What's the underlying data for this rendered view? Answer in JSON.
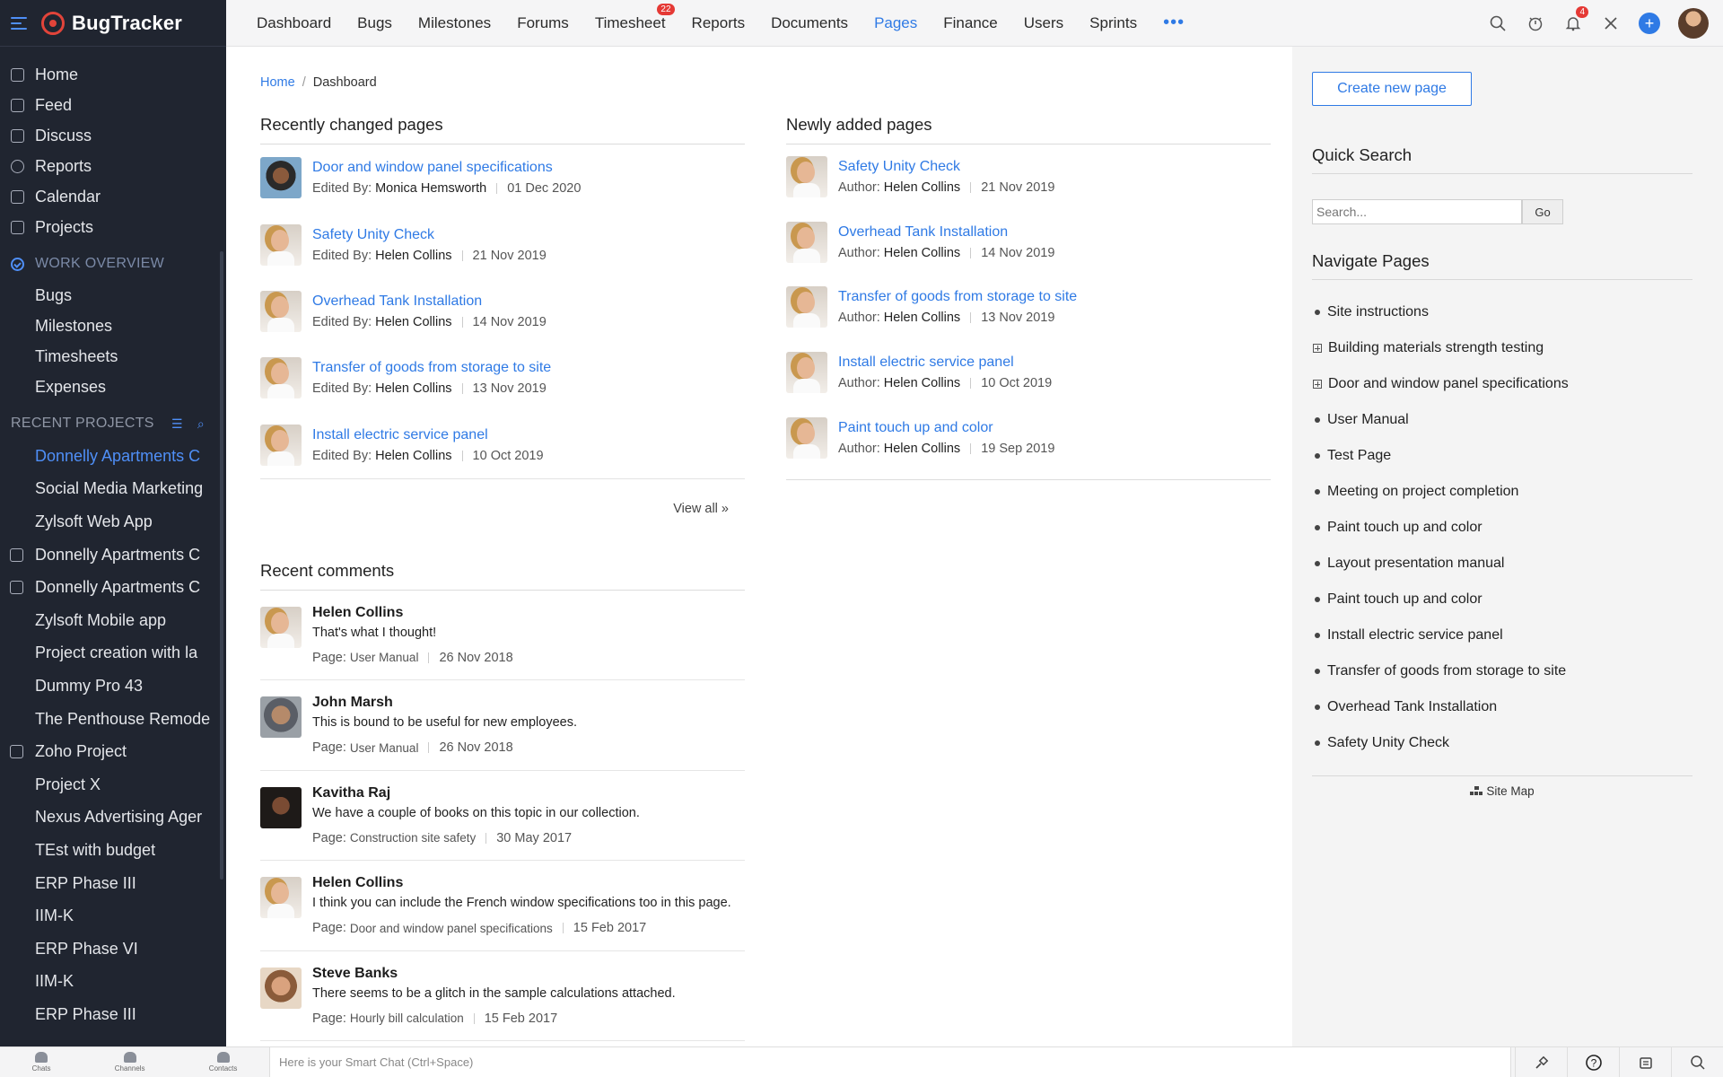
{
  "app": {
    "name": "BugTracker"
  },
  "sidebar": {
    "main_items": [
      {
        "label": "Home",
        "icon": "home-icon"
      },
      {
        "label": "Feed",
        "icon": "feed-icon"
      },
      {
        "label": "Discuss",
        "icon": "discuss-icon"
      },
      {
        "label": "Reports",
        "icon": "reports-icon"
      },
      {
        "label": "Calendar",
        "icon": "calendar-icon"
      },
      {
        "label": "Projects",
        "icon": "projects-icon"
      }
    ],
    "work_overview": {
      "heading": "WORK OVERVIEW",
      "items": [
        "Bugs",
        "Milestones",
        "Timesheets",
        "Expenses"
      ]
    },
    "recent_projects": {
      "heading": "RECENT PROJECTS",
      "items": [
        {
          "label": "Donnelly Apartments C",
          "active": true,
          "icon": false
        },
        {
          "label": "Social Media Marketing",
          "active": false,
          "icon": false
        },
        {
          "label": "Zylsoft Web App",
          "active": false,
          "icon": false
        },
        {
          "label": "Donnelly Apartments C",
          "active": false,
          "icon": true
        },
        {
          "label": "Donnelly Apartments C",
          "active": false,
          "icon": true
        },
        {
          "label": "Zylsoft Mobile app",
          "active": false,
          "icon": false
        },
        {
          "label": "Project creation with la",
          "active": false,
          "icon": false
        },
        {
          "label": "Dummy Pro 43",
          "active": false,
          "icon": false
        },
        {
          "label": "The Penthouse Remode",
          "active": false,
          "icon": false
        },
        {
          "label": "Zoho Project",
          "active": false,
          "icon": true
        },
        {
          "label": "Project X",
          "active": false,
          "icon": false
        },
        {
          "label": "Nexus Advertising Ager",
          "active": false,
          "icon": false
        },
        {
          "label": "TEst with budget",
          "active": false,
          "icon": false
        },
        {
          "label": "ERP Phase III",
          "active": false,
          "icon": false
        },
        {
          "label": "IIM-K",
          "active": false,
          "icon": false
        },
        {
          "label": "ERP Phase VI",
          "active": false,
          "icon": false
        },
        {
          "label": "IIM-K",
          "active": false,
          "icon": false
        },
        {
          "label": "ERP Phase III",
          "active": false,
          "icon": false
        }
      ]
    }
  },
  "topnav": {
    "items": [
      {
        "label": "Dashboard",
        "badge": ""
      },
      {
        "label": "Bugs",
        "badge": ""
      },
      {
        "label": "Milestones",
        "badge": ""
      },
      {
        "label": "Forums",
        "badge": ""
      },
      {
        "label": "Timesheet",
        "badge": "22"
      },
      {
        "label": "Reports",
        "badge": ""
      },
      {
        "label": "Documents",
        "badge": ""
      },
      {
        "label": "Pages",
        "badge": "",
        "active": true
      },
      {
        "label": "Finance",
        "badge": ""
      },
      {
        "label": "Users",
        "badge": ""
      },
      {
        "label": "Sprints",
        "badge": ""
      }
    ],
    "more": "•••",
    "notification_badge": "4",
    "accent": "#2f7ae5"
  },
  "breadcrumb": {
    "home": "Home",
    "separator": "/",
    "current": "Dashboard"
  },
  "recently_changed": {
    "title": "Recently changed pages",
    "meta_label": "Edited By:",
    "items": [
      {
        "title": "Door and window panel specifications",
        "by": "Monica Hemsworth",
        "date": "01 Dec 2020",
        "avatar": "monica"
      },
      {
        "title": "Safety Unity Check",
        "by": "Helen Collins",
        "date": "21 Nov 2019",
        "avatar": "helen"
      },
      {
        "title": "Overhead Tank Installation",
        "by": "Helen Collins",
        "date": "14 Nov 2019",
        "avatar": "helen"
      },
      {
        "title": "Transfer of goods from storage to site",
        "by": "Helen Collins",
        "date": "13 Nov 2019",
        "avatar": "helen"
      },
      {
        "title": "Install electric service panel",
        "by": "Helen Collins",
        "date": "10 Oct 2019",
        "avatar": "helen"
      }
    ],
    "view_all": "View all »"
  },
  "newly_added": {
    "title": "Newly added pages",
    "meta_label": "Author:",
    "items": [
      {
        "title": "Safety Unity Check",
        "by": "Helen Collins",
        "date": "21 Nov 2019"
      },
      {
        "title": "Overhead Tank Installation",
        "by": "Helen Collins",
        "date": "14 Nov 2019"
      },
      {
        "title": "Transfer of goods from storage to site",
        "by": "Helen Collins",
        "date": "13 Nov 2019"
      },
      {
        "title": "Install electric service panel",
        "by": "Helen Collins",
        "date": "10 Oct 2019"
      },
      {
        "title": "Paint touch up and color",
        "by": "Helen Collins",
        "date": "19 Sep 2019"
      }
    ]
  },
  "recent_comments": {
    "title": "Recent comments",
    "page_label": "Page:",
    "items": [
      {
        "name": "Helen Collins",
        "text": "That's what I thought!",
        "page": "User Manual",
        "date": "26 Nov 2018",
        "avatar": "helen"
      },
      {
        "name": "John Marsh",
        "text": "This is bound to be useful for new employees.",
        "page": "User Manual",
        "date": "26 Nov 2018",
        "avatar": "john"
      },
      {
        "name": "Kavitha Raj",
        "text": "We have a couple of books on this topic in our collection.",
        "page": "Construction site safety",
        "date": "30 May 2017",
        "avatar": "kavitha"
      },
      {
        "name": "Helen Collins",
        "text": "I think you can include the French window specifications too in this page.",
        "page": "Door and window panel specifications",
        "date": "15 Feb 2017",
        "avatar": "helen"
      },
      {
        "name": "Steve Banks",
        "text": "There seems to be a glitch in the sample calculations attached.",
        "page": "Hourly bill calculation",
        "date": "15 Feb 2017",
        "avatar": "steve"
      }
    ]
  },
  "right_panel": {
    "create_button": "Create new page",
    "quick_search": {
      "title": "Quick Search",
      "placeholder": "Search...",
      "go": "Go"
    },
    "navigate": {
      "title": "Navigate Pages",
      "items": [
        {
          "label": "Site instructions",
          "expandable": false
        },
        {
          "label": "Building materials strength testing",
          "expandable": true
        },
        {
          "label": "Door and window panel specifications",
          "expandable": true
        },
        {
          "label": "User Manual",
          "expandable": false
        },
        {
          "label": "Test Page",
          "expandable": false
        },
        {
          "label": "Meeting on project completion",
          "expandable": false
        },
        {
          "label": "Paint touch up and color",
          "expandable": false
        },
        {
          "label": "Layout presentation manual",
          "expandable": false
        },
        {
          "label": "Paint touch up and color",
          "expandable": false
        },
        {
          "label": "Install electric service panel",
          "expandable": false
        },
        {
          "label": "Transfer of goods from storage to site",
          "expandable": false
        },
        {
          "label": "Overhead Tank Installation",
          "expandable": false
        },
        {
          "label": "Safety Unity Check",
          "expandable": false
        }
      ]
    },
    "site_map": "Site Map"
  },
  "bottombar": {
    "items": [
      "Chats",
      "Channels",
      "Contacts"
    ],
    "smart_chat_placeholder": "Here is your Smart Chat (Ctrl+Space)"
  }
}
